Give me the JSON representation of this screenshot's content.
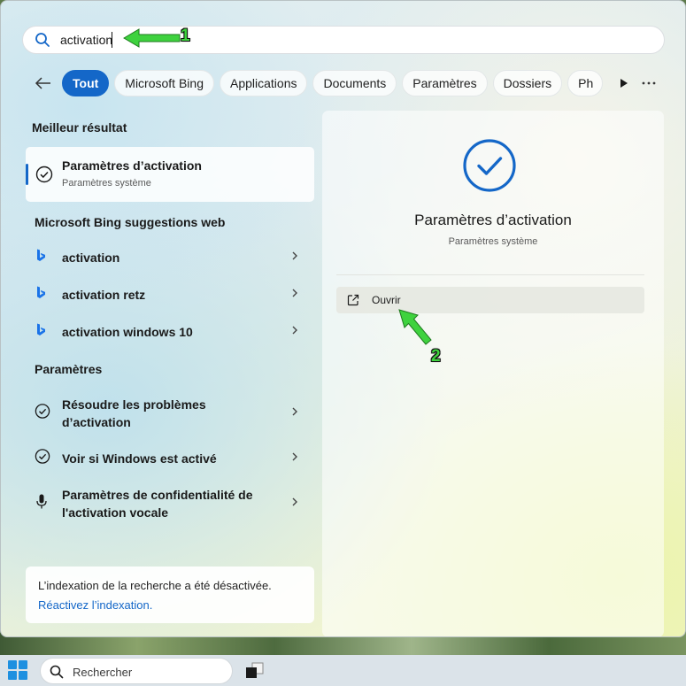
{
  "search": {
    "value": "activation"
  },
  "filters": [
    "Tout",
    "Microsoft Bing",
    "Applications",
    "Documents",
    "Paramètres",
    "Dossiers",
    "Ph"
  ],
  "best_match": {
    "section_title": "Meilleur résultat",
    "title": "Paramètres d’activation",
    "subtitle": "Paramètres système"
  },
  "bing": {
    "section_title": "Microsoft Bing suggestions web",
    "items": [
      "activation",
      "activation retz",
      "activation windows 10"
    ]
  },
  "settings": {
    "section_title": "Paramètres",
    "items": [
      {
        "line1": "Résoudre les problèmes",
        "line2": "d’activation"
      },
      {
        "line1": "Voir si Windows est activé",
        "line2": ""
      },
      {
        "line1": "Paramètres de confidentialité de",
        "line2": "l'activation vocale"
      }
    ]
  },
  "indexing": {
    "message": "L’indexation de la recherche a été désactivée.",
    "link": "Réactivez l’indexation."
  },
  "preview": {
    "title": "Paramètres d’activation",
    "subtitle": "Paramètres système",
    "open_label": "Ouvrir"
  },
  "annotations": {
    "step1": "1",
    "step2": "2",
    "color": "#3ed23e"
  },
  "taskbar": {
    "search_placeholder": "Rechercher"
  },
  "colors": {
    "accent": "#1467c8",
    "bing_icon": "#1a73e8"
  }
}
